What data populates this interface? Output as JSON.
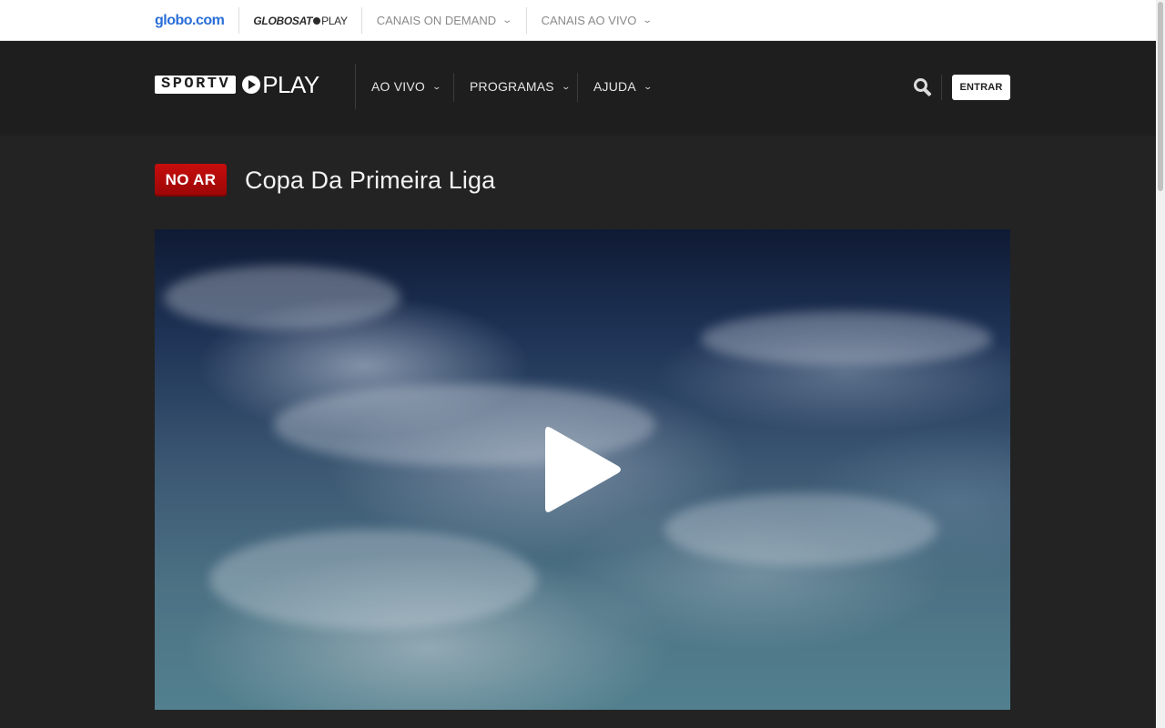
{
  "topbar": {
    "globo_logo": "globo.com",
    "globosat_play": {
      "brand": "GLOBOSAT",
      "suffix": "PLAY"
    },
    "menu": [
      {
        "label": "CANAIS ON DEMAND"
      },
      {
        "label": "CANAIS AO VIVO"
      }
    ]
  },
  "header": {
    "logo": {
      "sportv": "SPORTV",
      "play": "PLAY"
    },
    "nav": [
      {
        "label": "AO VIVO"
      },
      {
        "label": "PROGRAMAS"
      },
      {
        "label": "AJUDA"
      }
    ],
    "login_label": "ENTRAR"
  },
  "live": {
    "badge": "NO AR",
    "title": "Copa Da Primeira Liga"
  },
  "colors": {
    "globo_blue": "#2a6ed8",
    "header_bg": "#1e1e1e",
    "page_bg": "#232323",
    "live_red": "#c70d0d"
  }
}
